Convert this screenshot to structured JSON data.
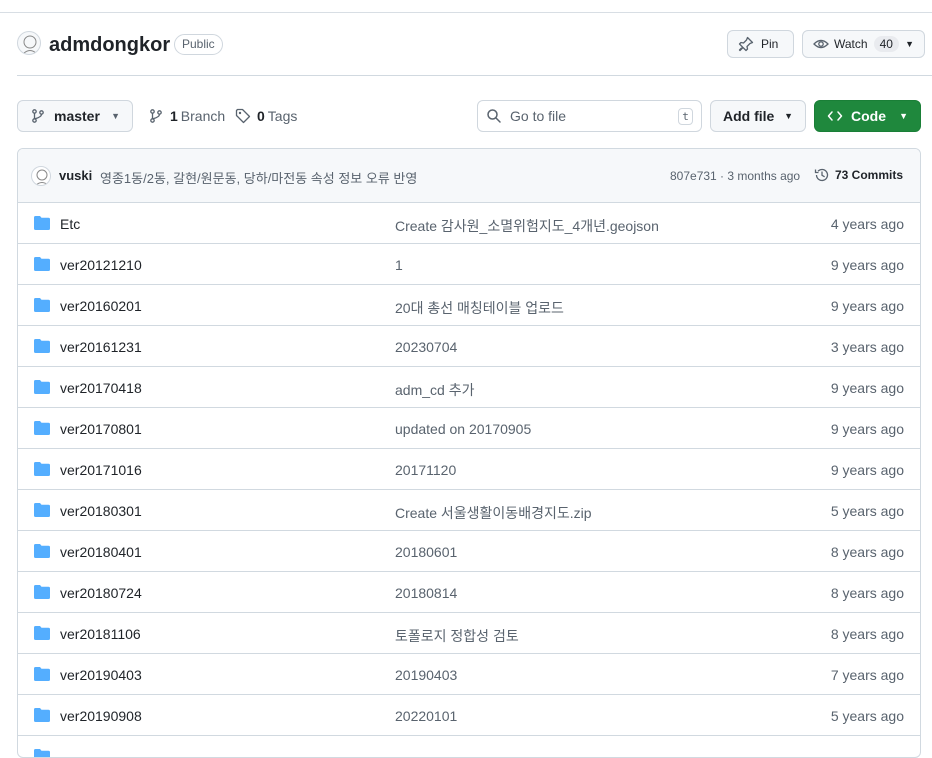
{
  "repo": {
    "name": "admdongkor",
    "visibility": "Public",
    "pin_label": "Pin",
    "watch_label": "Watch",
    "watch_count": "40"
  },
  "toolbar": {
    "branch": "master",
    "branch_count": "1",
    "branch_label": "Branch",
    "tag_count": "0",
    "tag_label": "Tags",
    "search_placeholder": "Go to file",
    "search_shortcut": "t",
    "add_file_label": "Add file",
    "code_label": "Code"
  },
  "latest_commit": {
    "author": "vuski",
    "message": "영종1동/2동, 갈현/원문동, 당하/마전동 속성 정보 오류 반영",
    "hash_time": "807e731 · 3 months ago",
    "commits_label": "73 Commits"
  },
  "files": [
    {
      "name": "Etc",
      "message": "Create 감사원_소멸위험지도_4개년.geojson",
      "age": "4 years ago"
    },
    {
      "name": "ver20121210",
      "message": "1",
      "age": "9 years ago"
    },
    {
      "name": "ver20160201",
      "message": "20대 총선 매칭테이블 업로드",
      "age": "9 years ago"
    },
    {
      "name": "ver20161231",
      "message": "20230704",
      "age": "3 years ago"
    },
    {
      "name": "ver20170418",
      "message": "adm_cd 추가",
      "age": "9 years ago"
    },
    {
      "name": "ver20170801",
      "message": "updated on 20170905",
      "age": "9 years ago"
    },
    {
      "name": "ver20171016",
      "message": "20171120",
      "age": "9 years ago"
    },
    {
      "name": "ver20180301",
      "message": "Create 서울생활이동배경지도.zip",
      "age": "5 years ago"
    },
    {
      "name": "ver20180401",
      "message": "20180601",
      "age": "8 years ago"
    },
    {
      "name": "ver20180724",
      "message": "20180814",
      "age": "8 years ago"
    },
    {
      "name": "ver20181106",
      "message": "토폴로지 정합성 검토",
      "age": "8 years ago"
    },
    {
      "name": "ver20190403",
      "message": "20190403",
      "age": "7 years ago"
    },
    {
      "name": "ver20190908",
      "message": "20220101",
      "age": "5 years ago"
    },
    {
      "name": "",
      "message": "",
      "age": ""
    }
  ],
  "colors": {
    "accent_green": "#1f883d",
    "folder_blue": "#54aeff",
    "muted_text": "#59636e"
  }
}
